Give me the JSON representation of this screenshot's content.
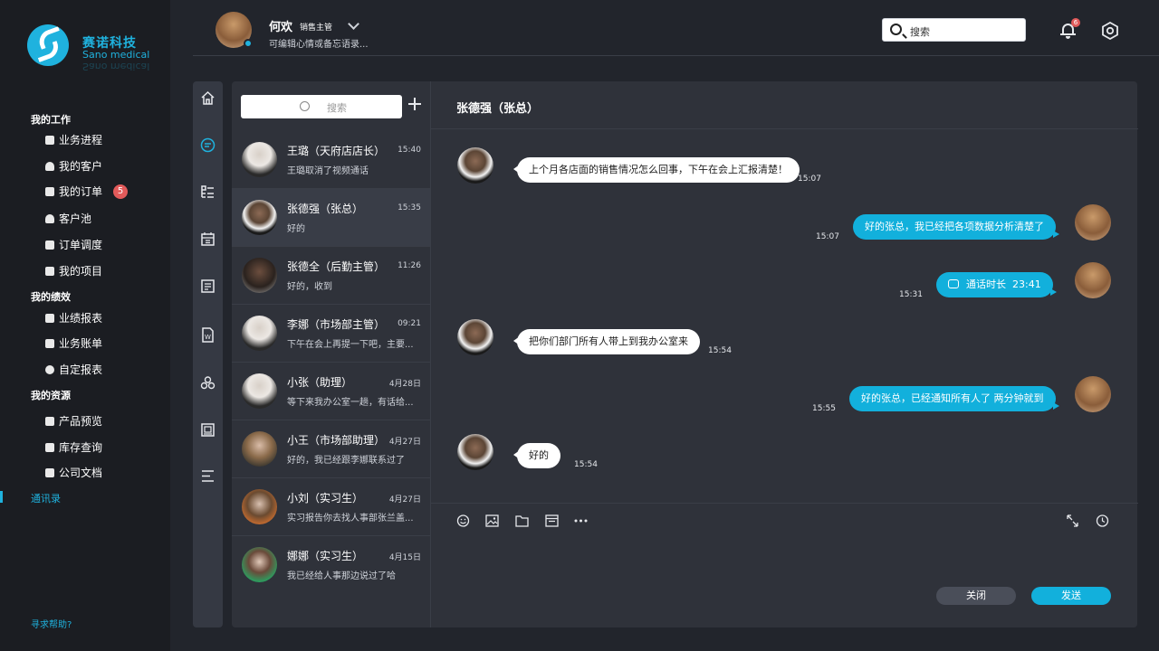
{
  "brand": {
    "name_cn": "赛诺科技",
    "name_en": "Sano medical"
  },
  "colors": {
    "accent": "#1fb2de",
    "badge": "#e25a5a",
    "bg": "#22252c",
    "panel": "#2f323a"
  },
  "sidebar": {
    "sections": [
      {
        "title": "我的工作",
        "items": [
          {
            "label": "业务进程",
            "icon": "book-icon"
          },
          {
            "label": "我的客户",
            "icon": "person-icon"
          },
          {
            "label": "我的订单",
            "icon": "document-icon",
            "badge": "5"
          },
          {
            "label": "客户池",
            "icon": "group-icon"
          },
          {
            "label": "订单调度",
            "icon": "schedule-icon"
          },
          {
            "label": "我的项目",
            "icon": "stack-icon"
          }
        ]
      },
      {
        "title": "我的绩效",
        "items": [
          {
            "label": "业绩报表",
            "icon": "chart-icon"
          },
          {
            "label": "业务账单",
            "icon": "bill-icon"
          },
          {
            "label": "自定报表",
            "icon": "pie-icon"
          }
        ]
      },
      {
        "title": "我的资源",
        "items": [
          {
            "label": "产品预览",
            "icon": "preview-icon"
          },
          {
            "label": "库存查询",
            "icon": "inventory-icon"
          },
          {
            "label": "公司文档",
            "icon": "files-icon"
          }
        ]
      }
    ],
    "active": "通讯录",
    "help": "寻求帮助?"
  },
  "header": {
    "user_name": "何欢",
    "user_role": "销售主管",
    "user_status": "可编辑心情或备忘语录...",
    "search_placeholder": "搜索",
    "notification_count": "6"
  },
  "contacts": {
    "search_placeholder": "搜索",
    "items": [
      {
        "name": "王璐（天府店店长）",
        "time": "15:40",
        "msg": "王璐取消了视频通话"
      },
      {
        "name": "张德强（张总）",
        "time": "15:35",
        "msg": "好的"
      },
      {
        "name": "张德全（后勤主管）",
        "time": "11:26",
        "msg": "好的，收到"
      },
      {
        "name": "李娜（市场部主管）",
        "time": "09:21",
        "msg": "下午在会上再提一下吧，主要..."
      },
      {
        "name": "小张（助理）",
        "time": "4月28日",
        "msg": "等下来我办公室一趟，有话给..."
      },
      {
        "name": "小王（市场部助理）",
        "time": "4月27日",
        "msg": "好的，我已经跟李娜联系过了"
      },
      {
        "name": "小刘（实习生）",
        "time": "4月27日",
        "msg": "实习报告你去找人事部张兰盖..."
      },
      {
        "name": "娜娜（实习生）",
        "time": "4月15日",
        "msg": "我已经给人事那边说过了哈"
      }
    ]
  },
  "chat": {
    "title": "张德强（张总）",
    "messages": [
      {
        "dir": "in",
        "text": "上个月各店面的销售情况怎么回事，下午在会上汇报清楚！",
        "time": "15:07"
      },
      {
        "dir": "out",
        "text": "好的张总，我已经把各项数据分析清楚了",
        "time": "15:07"
      },
      {
        "dir": "out",
        "text": "通话时长",
        "duration": "23:41",
        "time": "15:31"
      },
      {
        "dir": "in",
        "text": "把你们部门所有人带上到我办公室来",
        "time": "15:54"
      },
      {
        "dir": "out",
        "text": "好的张总，已经通知所有人了 两分钟就到",
        "time": "15:55"
      },
      {
        "dir": "in",
        "text": "好的",
        "time": "15:54"
      }
    ],
    "close_label": "关闭",
    "send_label": "发送"
  }
}
